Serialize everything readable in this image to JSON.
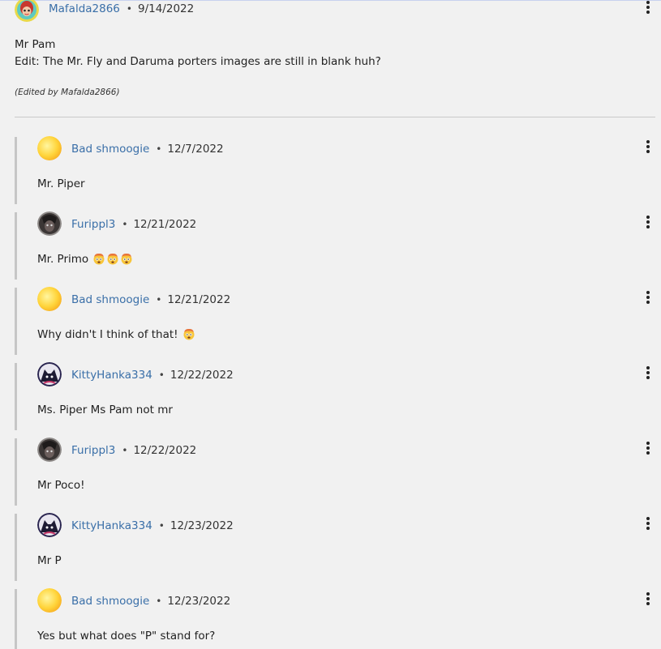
{
  "top_comment": {
    "username": "Mafalda2866",
    "separator": "•",
    "date": "9/14/2022",
    "lines": [
      "Mr Pam",
      "Edit: The Mr. Fly and Daruma porters images are still in blank huh?"
    ],
    "edited_note": "(Edited by Mafalda2866)",
    "avatar_icon": "anime-avatar-icon"
  },
  "replies": [
    {
      "username": "Bad shmoogie",
      "date": "12/7/2022",
      "text": "Mr. Piper",
      "emoji_count": 0,
      "avatar": "yellow-orb"
    },
    {
      "username": "Furippl3",
      "date": "12/21/2022",
      "text": "Mr. Primo ",
      "emoji_count": 3,
      "avatar": "dark-character"
    },
    {
      "username": "Bad shmoogie",
      "date": "12/21/2022",
      "text": "Why didn't I think of that! ",
      "emoji_count": 1,
      "avatar": "yellow-orb"
    },
    {
      "username": "KittyHanka334",
      "date": "12/22/2022",
      "text": "Ms. Piper Ms Pam not mr",
      "emoji_count": 0,
      "avatar": "dark-cat"
    },
    {
      "username": "Furippl3",
      "date": "12/22/2022",
      "text": "Mr Poco!",
      "emoji_count": 0,
      "avatar": "dark-character"
    },
    {
      "username": "KittyHanka334",
      "date": "12/23/2022",
      "text": "Mr P",
      "emoji_count": 0,
      "avatar": "dark-cat"
    },
    {
      "username": "Bad shmoogie",
      "date": "12/23/2022",
      "text": "Yes but what does \"P\" stand for?",
      "emoji_count": 0,
      "avatar": "yellow-orb"
    }
  ],
  "colors": {
    "background": "#f1f1f1",
    "username_link": "#3a6fa8",
    "reply_bar": "#c6c6c6",
    "divider": "#c9c9c9"
  },
  "icons": {
    "more_menu": "kebab-menu-icon",
    "emoji": "exploding-head-emoji"
  }
}
